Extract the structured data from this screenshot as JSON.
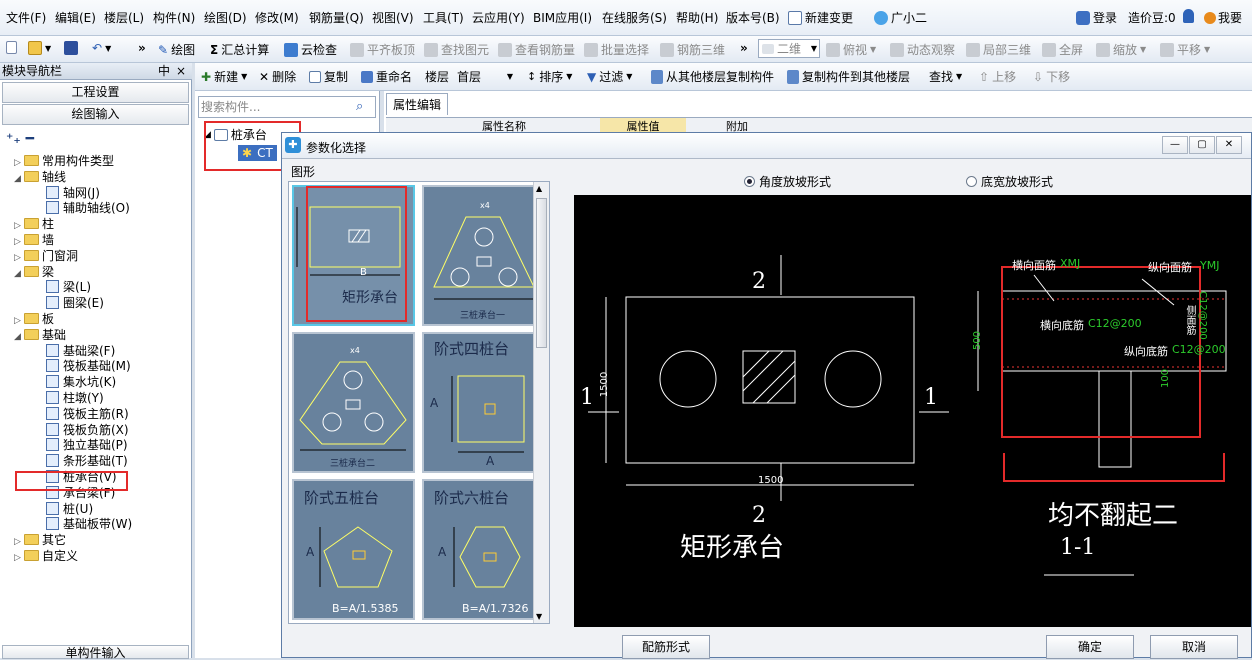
{
  "menubar": {
    "items": [
      "文件(F)",
      "编辑(E)",
      "楼层(L)",
      "构件(N)",
      "绘图(D)",
      "修改(M)",
      "钢筋量(Q)",
      "视图(V)",
      "工具(T)",
      "云应用(Y)",
      "BIM应用(I)",
      "在线服务(S)",
      "帮助(H)",
      "版本号(B)"
    ],
    "new_change": "新建变更",
    "assistant": "广小二",
    "login": "登录",
    "price_beans": "造价豆:0",
    "want": "我要"
  },
  "toolbar1": {
    "draw": "绘图",
    "sum_calc": "汇总计算",
    "cloud_check": "云检查",
    "align_slab": "平齐板顶",
    "find_element": "查找图元",
    "view_rebar": "查看钢筋量",
    "batch_select": "批量选择",
    "rebar_3d": "钢筋三维",
    "view_mode": "二维",
    "top_view": "俯视",
    "dynamic_observe": "动态观察",
    "local_3d": "局部三维",
    "fullscreen": "全屏",
    "zoom": "缩放",
    "pan": "平移"
  },
  "leftpanel": {
    "title": "模块导航栏",
    "pin": "中",
    "close": "×",
    "project_settings": "工程设置",
    "drawing_input": "绘图输入",
    "bottom": "单构件输入",
    "tree": [
      {
        "label": "常用构件类型",
        "level": 0,
        "type": "folder",
        "expanded": false
      },
      {
        "label": "轴线",
        "level": 0,
        "type": "folder",
        "expanded": true
      },
      {
        "label": "轴网(J)",
        "level": 1,
        "type": "leaf"
      },
      {
        "label": "辅助轴线(O)",
        "level": 1,
        "type": "leaf"
      },
      {
        "label": "柱",
        "level": 0,
        "type": "folder",
        "expanded": false
      },
      {
        "label": "墙",
        "level": 0,
        "type": "folder",
        "expanded": false
      },
      {
        "label": "门窗洞",
        "level": 0,
        "type": "folder",
        "expanded": false
      },
      {
        "label": "梁",
        "level": 0,
        "type": "folder",
        "expanded": true
      },
      {
        "label": "梁(L)",
        "level": 1,
        "type": "leaf"
      },
      {
        "label": "圈梁(E)",
        "level": 1,
        "type": "leaf"
      },
      {
        "label": "板",
        "level": 0,
        "type": "folder",
        "expanded": false
      },
      {
        "label": "基础",
        "level": 0,
        "type": "folder",
        "expanded": true
      },
      {
        "label": "基础梁(F)",
        "level": 1,
        "type": "leaf"
      },
      {
        "label": "筏板基础(M)",
        "level": 1,
        "type": "leaf"
      },
      {
        "label": "集水坑(K)",
        "level": 1,
        "type": "leaf"
      },
      {
        "label": "柱墩(Y)",
        "level": 1,
        "type": "leaf"
      },
      {
        "label": "筏板主筋(R)",
        "level": 1,
        "type": "leaf"
      },
      {
        "label": "筏板负筋(X)",
        "level": 1,
        "type": "leaf"
      },
      {
        "label": "独立基础(P)",
        "level": 1,
        "type": "leaf"
      },
      {
        "label": "条形基础(T)",
        "level": 1,
        "type": "leaf"
      },
      {
        "label": "桩承台(V)",
        "level": 1,
        "type": "leaf"
      },
      {
        "label": "承台梁(F)",
        "level": 1,
        "type": "leaf"
      },
      {
        "label": "桩(U)",
        "level": 1,
        "type": "leaf"
      },
      {
        "label": "基础板带(W)",
        "level": 1,
        "type": "leaf"
      },
      {
        "label": "其它",
        "level": 0,
        "type": "folder",
        "expanded": false
      },
      {
        "label": "自定义",
        "level": 0,
        "type": "folder",
        "expanded": false
      }
    ]
  },
  "toolbar2": {
    "new": "新建",
    "delete": "删除",
    "copy": "复制",
    "rename": "重命名",
    "floor_label": "楼层",
    "floor_value": "首层",
    "sort": "排序",
    "filter": "过滤",
    "copy_from_other": "从其他楼层复制构件",
    "copy_to_other": "复制构件到其他楼层",
    "find": "查找",
    "move_up": "上移",
    "move_down": "下移"
  },
  "midpanel": {
    "search_placeholder": "搜索构件...",
    "tree_root": "桩承台",
    "tree_child": "CT",
    "prop_tab": "属性编辑",
    "prop_col_name": "属性名称",
    "prop_col_value": "属性值",
    "prop_col_extra": "附加"
  },
  "dialog": {
    "title": "参数化选择",
    "group_label": "图形",
    "thumbnails": [
      {
        "label": "矩形承台",
        "dim": "B",
        "selected": true
      },
      {
        "label": "三桩承台一",
        "dim": "x4",
        "selected": false
      },
      {
        "label": "三桩承台二",
        "dim": "x4",
        "selected": false
      },
      {
        "label": "阶式四桩台",
        "dim": "A",
        "selected": false
      },
      {
        "label": "阶式五桩台",
        "dim": "A",
        "formula": "B=A/1.5385",
        "selected": false
      },
      {
        "label": "阶式六桩台",
        "dim": "A",
        "formula": "B=A/1.7326",
        "selected": false
      }
    ],
    "radio_angle": "角度放坡形式",
    "radio_width": "底宽放坡形式",
    "btn_rebar": "配筋形式",
    "btn_ok": "确定",
    "btn_cancel": "取消",
    "drawing": {
      "plan_title": "矩形承台",
      "plan_section_top": "2",
      "plan_section_bottom": "2",
      "plan_side_left": "1",
      "plan_side_right": "1",
      "plan_dim_h": "1500",
      "plan_dim_w": "1500",
      "section_title": "均不翻起二",
      "section_sub": "1-1",
      "top_trans_bar": "横向面筋",
      "top_trans_val": "XMJ",
      "top_long_bar": "纵向面筋",
      "top_long_val": "YMJ",
      "bot_trans_bar": "横向底筋",
      "bot_trans_val": "C12@200",
      "bot_long_bar": "纵向底筋",
      "bot_long_val": "C12@200",
      "side_bar": "C12@200",
      "side_label": "侧面筋",
      "dim_500": "500",
      "dim_100": "100"
    }
  }
}
